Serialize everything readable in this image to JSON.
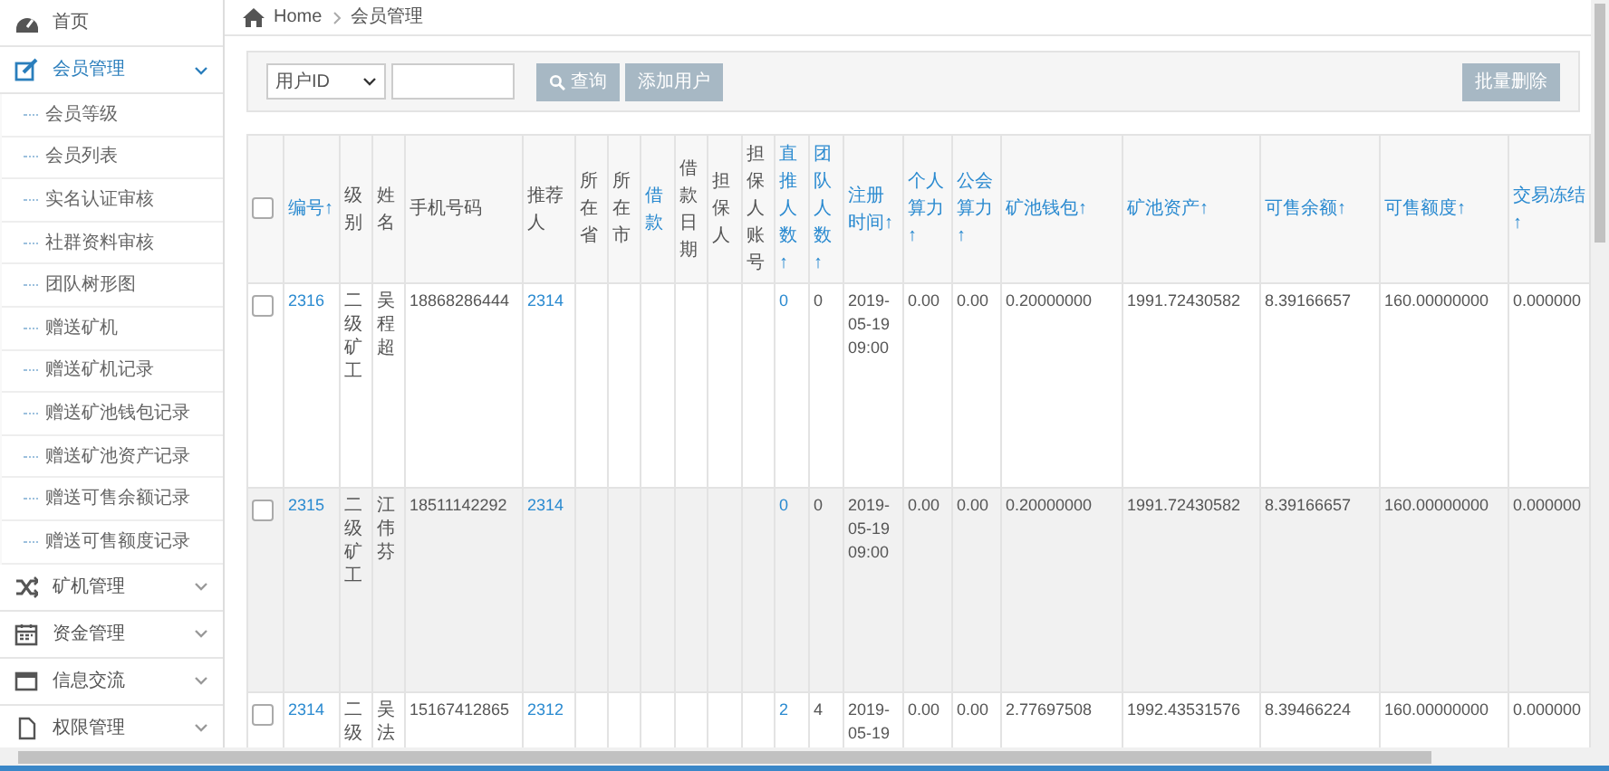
{
  "sidebar": {
    "items": [
      {
        "kind": "link",
        "label": "首页"
      },
      {
        "kind": "group",
        "label": "会员管理",
        "expanded": true,
        "children": [
          {
            "label": "会员等级"
          },
          {
            "label": "会员列表"
          },
          {
            "label": "实名认证审核"
          },
          {
            "label": "社群资料审核"
          },
          {
            "label": "团队树形图"
          },
          {
            "label": "赠送矿机"
          },
          {
            "label": "赠送矿机记录"
          },
          {
            "label": "赠送矿池钱包记录"
          },
          {
            "label": "赠送矿池资产记录"
          },
          {
            "label": "赠送可售余额记录"
          },
          {
            "label": "赠送可售额度记录"
          }
        ]
      },
      {
        "kind": "group",
        "label": "矿机管理",
        "expanded": false
      },
      {
        "kind": "group",
        "label": "资金管理",
        "expanded": false
      },
      {
        "kind": "group",
        "label": "信息交流",
        "expanded": false
      },
      {
        "kind": "group",
        "label": "权限管理",
        "expanded": false
      }
    ]
  },
  "breadcrumb": [
    "Home",
    "会员管理"
  ],
  "filter": {
    "select_value": "用户ID",
    "query_button": "查询",
    "add_button": "添加用户",
    "delete_button": "批量删除"
  },
  "table": {
    "select_all_checked": false,
    "columns": [
      {
        "label": "编号↑",
        "sortable": true,
        "kind": "link"
      },
      {
        "label": "级别",
        "sortable": false,
        "kind": "vertical"
      },
      {
        "label": "姓名",
        "sortable": false,
        "kind": "vertical"
      },
      {
        "label": "手机号码",
        "sortable": false,
        "kind": "text"
      },
      {
        "label": "推荐人",
        "sortable": false,
        "kind": "link"
      },
      {
        "label": "所在省",
        "sortable": false,
        "kind": "text"
      },
      {
        "label": "所在市",
        "sortable": false,
        "kind": "text"
      },
      {
        "label": "借款",
        "sortable": true,
        "kind": "text"
      },
      {
        "label": "借款日期",
        "sortable": false,
        "kind": "text"
      },
      {
        "label": "担保人",
        "sortable": false,
        "kind": "text"
      },
      {
        "label": "担保人账号",
        "sortable": false,
        "kind": "text"
      },
      {
        "label": "直推人数↑",
        "sortable": true,
        "kind": "link"
      },
      {
        "label": "团队人数↑",
        "sortable": true,
        "kind": "text"
      },
      {
        "label": "注册时间↑",
        "sortable": true,
        "kind": "text"
      },
      {
        "label": "个人算力↑",
        "sortable": true,
        "kind": "text"
      },
      {
        "label": "公会算力↑",
        "sortable": true,
        "kind": "text"
      },
      {
        "label": "矿池钱包↑",
        "sortable": true,
        "kind": "text"
      },
      {
        "label": "矿池资产↑",
        "sortable": true,
        "kind": "text"
      },
      {
        "label": "可售余额↑",
        "sortable": true,
        "kind": "text"
      },
      {
        "label": "可售额度↑",
        "sortable": true,
        "kind": "text"
      },
      {
        "label": "交易冻结↑",
        "sortable": true,
        "kind": "text"
      }
    ],
    "rows": [
      {
        "checked": false,
        "cells": [
          "2316",
          "二级矿工",
          "吴程超",
          "18868286444",
          "2314",
          null,
          null,
          null,
          null,
          null,
          null,
          "0",
          "0",
          "2019-05-19 09:00",
          "0.00",
          "0.00",
          "0.20000000",
          "1991.72430582",
          "8.39166657",
          "160.00000000",
          "0.000000"
        ]
      },
      {
        "checked": false,
        "cells": [
          "2315",
          "二级矿工",
          "江伟芬",
          "18511142292",
          "2314",
          null,
          null,
          null,
          null,
          null,
          null,
          "0",
          "0",
          "2019-05-19 09:00",
          "0.00",
          "0.00",
          "0.20000000",
          "1991.72430582",
          "8.39166657",
          "160.00000000",
          "0.000000"
        ]
      },
      {
        "checked": false,
        "cells": [
          "2314",
          "二级",
          "吴法",
          "15167412865",
          "2312",
          null,
          null,
          null,
          null,
          null,
          null,
          "2",
          "4",
          "2019-05-19",
          "0.00",
          "0.00",
          "2.77697508",
          "1992.43531576",
          "8.39466224",
          "160.00000000",
          "0.000000"
        ]
      }
    ]
  }
}
